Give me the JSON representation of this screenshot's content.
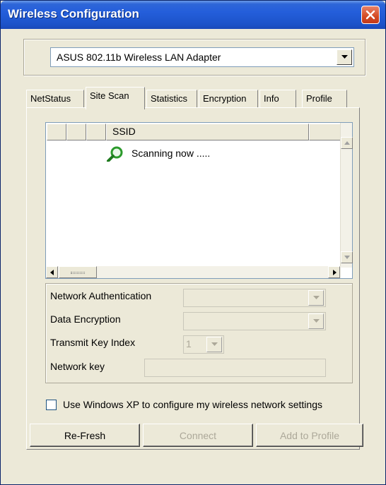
{
  "window": {
    "title": "Wireless Configuration"
  },
  "adapter": {
    "selected": "ASUS 802.11b Wireless LAN Adapter"
  },
  "tabs": [
    {
      "label": "NetStatus"
    },
    {
      "label": "Site Scan"
    },
    {
      "label": "Statistics"
    },
    {
      "label": "Encryption"
    },
    {
      "label": "Info"
    },
    {
      "label": "Profile"
    }
  ],
  "active_tab": "Site Scan",
  "site_list": {
    "columns": [
      "",
      "",
      "",
      "SSID",
      ""
    ],
    "status": "Scanning now ....."
  },
  "settings": {
    "auth_label": "Network Authentication",
    "encryption_label": "Data Encryption",
    "key_index_label": "Transmit Key Index",
    "key_index_value": "1",
    "network_key_label": "Network key"
  },
  "checkbox": {
    "label": "Use Windows XP to configure my wireless network settings",
    "checked": false
  },
  "buttons": {
    "refresh": "Re-Fresh",
    "connect": "Connect",
    "add_profile": "Add to Profile"
  },
  "icons": [
    "close-icon",
    "dropdown-arrow-icon",
    "search-icon",
    "scroll-up-icon",
    "scroll-down-icon",
    "scroll-left-icon",
    "scroll-right-icon"
  ],
  "colors": {
    "titlebar": "#245edb",
    "face": "#ece9d8",
    "close": "#d44a22",
    "scan_icon": "#2b9a2b"
  }
}
